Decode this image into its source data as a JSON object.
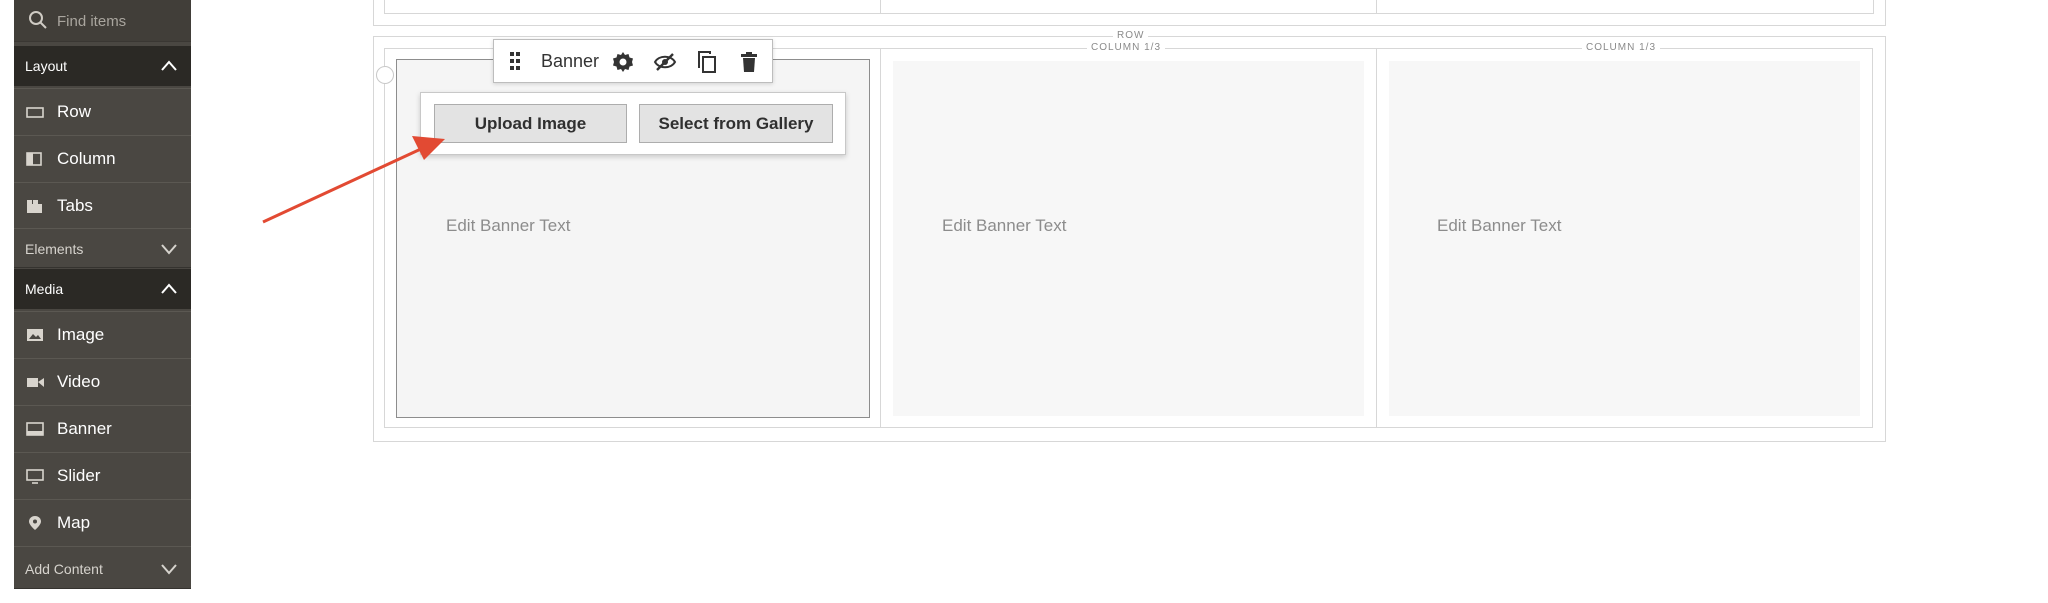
{
  "sidebar": {
    "search_placeholder": "Find items",
    "groups": {
      "layout": "Layout",
      "elements": "Elements",
      "media": "Media",
      "add_content": "Add Content"
    },
    "layout_items": [
      "Row",
      "Column",
      "Tabs"
    ],
    "media_items": [
      "Image",
      "Video",
      "Banner",
      "Slider",
      "Map"
    ]
  },
  "stage": {
    "row_label": "ROW",
    "column_label": "COLUMN 1/3",
    "banner_text": "Edit Banner Text"
  },
  "toolbar": {
    "title": "Banner",
    "icons": [
      "drag-handle-icon",
      "gear-icon",
      "hide-icon",
      "duplicate-icon",
      "trash-icon"
    ]
  },
  "upload": {
    "upload_label": "Upload Image",
    "gallery_label": "Select from Gallery"
  },
  "colors": {
    "sidebar_bg": "#4a4742",
    "sidebar_header_bg": "#2b2925",
    "arrow": "#e24a33"
  }
}
